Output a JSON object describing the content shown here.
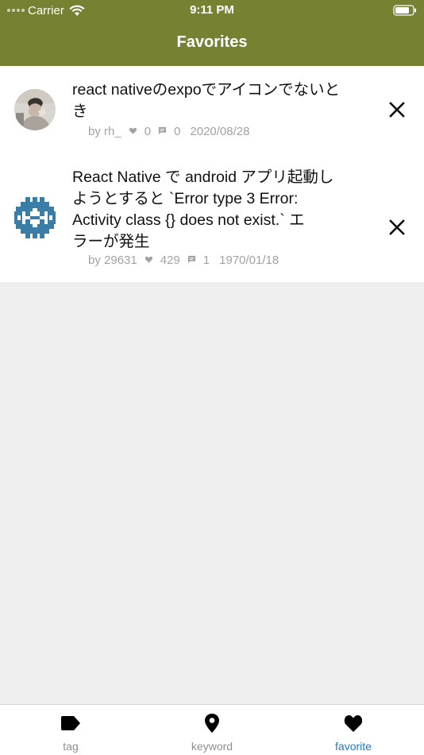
{
  "status_bar": {
    "carrier": "Carrier",
    "time": "9:11 PM"
  },
  "header": {
    "title": "Favorites",
    "background_color": "#768232"
  },
  "favorites": [
    {
      "title": "react nativeのexpoでアイコンでないとき",
      "title_lines": [
        "react nativeのexpoでアイコンでないと",
        "き"
      ],
      "author": "by rh_",
      "likes": "0",
      "comments": "0",
      "date": "2020/08/28",
      "avatar_icon": "user-photo-avatar"
    },
    {
      "title": "React Native で android アプリ起動しようとすると `Error type 3 Error: Activity class {} does not exist.` エラーが発生",
      "title_lines": [
        "React Native で android アプリ起動し",
        "ようとすると `Error type 3 Error:",
        "Activity class {} does not exist.` エ",
        "ラーが発生"
      ],
      "author": "by 29631",
      "likes": "429",
      "comments": "1",
      "date": "1970/01/18",
      "avatar_icon": "identicon-avatar"
    }
  ],
  "tab_bar": {
    "tabs": [
      {
        "label": "tag",
        "icon": "tag-icon",
        "active": false
      },
      {
        "label": "keyword",
        "icon": "location-pin-icon",
        "active": false
      },
      {
        "label": "favorite",
        "icon": "heart-icon",
        "active": true
      }
    ],
    "active_color": "#1a7bd6",
    "inactive_color": "#8e8e8e"
  }
}
